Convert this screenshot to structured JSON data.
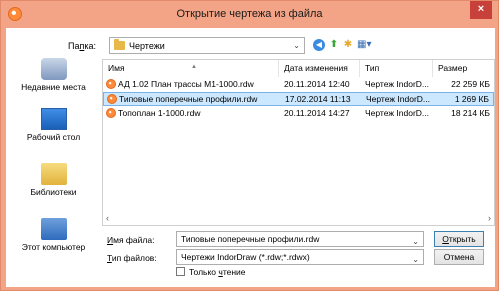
{
  "window": {
    "title": "Открытие чертежа из файла",
    "close_glyph": "×"
  },
  "topbar": {
    "folder_label_prefix": "Па",
    "folder_label_mnemonic": "п",
    "folder_label_suffix": "ка:",
    "folder_value": "Чертежи",
    "combo_arrow": "⌄",
    "icons": [
      "back-icon",
      "up-folder-icon",
      "new-folder-icon",
      "view-menu-icon"
    ]
  },
  "places": [
    {
      "label": "Недавние места",
      "icon": "recent-places-icon"
    },
    {
      "label": "Рабочий стол",
      "icon": "desktop-icon"
    },
    {
      "label": "Библиотеки",
      "icon": "libraries-icon"
    },
    {
      "label": "Этот компьютер",
      "icon": "computer-icon"
    }
  ],
  "filelist": {
    "columns": {
      "name": "Имя",
      "date": "Дата изменения",
      "type": "Тип",
      "size": "Размер"
    },
    "rows": [
      {
        "name": "АД 1.02 План трассы М1-1000.rdw",
        "date": "20.11.2014 12:40",
        "type": "Чертеж IndorD...",
        "size": "22 259 КБ"
      },
      {
        "name": "Типовые поперечные профили.rdw",
        "date": "17.02.2014 11:13",
        "type": "Чертеж IndorD...",
        "size": "1 269 КБ"
      },
      {
        "name": "Топоплан 1-1000.rdw",
        "date": "20.11.2014 14:27",
        "type": "Чертеж IndorD...",
        "size": "18 214 КБ"
      }
    ],
    "selected_index": 1,
    "scroll_left": "‹",
    "scroll_right": "›"
  },
  "bottom": {
    "filename_label_mnemonic": "И",
    "filename_label_rest": "мя файла:",
    "filename_value": "Типовые поперечные профили.rdw",
    "filetype_label_mnemonic": "Т",
    "filetype_label_rest": "ип файлов:",
    "filetype_value": "Чертежи IndorDraw (*.rdw;*.rdwx)",
    "readonly_label_prefix": "Только ",
    "readonly_label_mnemonic": "ч",
    "readonly_label_suffix": "тение",
    "open_button_mnemonic": "О",
    "open_button_rest": "ткрыть",
    "cancel_button": "Отмена"
  },
  "colors": {
    "frame": "#f4a486",
    "selection": "#cce8ff",
    "close": "#c7403a"
  }
}
